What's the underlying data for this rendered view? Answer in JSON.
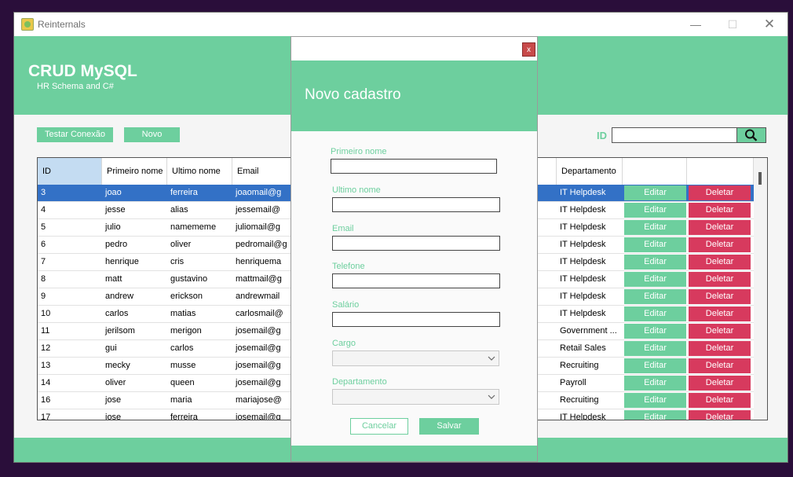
{
  "window": {
    "title": "Reinternals",
    "minimize_glyph": "—",
    "maximize_glyph": "☐",
    "close_glyph": "✕"
  },
  "header": {
    "title": "CRUD MySQL",
    "subtitle": "HR Schema and C#"
  },
  "toolbar": {
    "test_connection_label": "Testar Conexão",
    "new_label": "Novo",
    "id_label": "ID",
    "id_value": ""
  },
  "grid": {
    "columns": [
      "ID",
      "Primeiro nome",
      "Ultimo nome",
      "Email",
      "Departamento",
      "",
      ""
    ],
    "edit_label": "Editar",
    "delete_label": "Deletar",
    "rows": [
      {
        "id": "3",
        "first": "joao",
        "last": "ferreira",
        "email": "joaomail@g",
        "dept": "IT Helpdesk"
      },
      {
        "id": "4",
        "first": "jesse",
        "last": "alias",
        "email": "jessemail@",
        "dept": "IT Helpdesk"
      },
      {
        "id": "5",
        "first": "julio",
        "last": "namememe",
        "email": "juliomail@g",
        "dept": "IT Helpdesk"
      },
      {
        "id": "6",
        "first": "pedro",
        "last": "oliver",
        "email": "pedromail@g",
        "dept": "IT Helpdesk"
      },
      {
        "id": "7",
        "first": "henrique",
        "last": "cris",
        "email": "henriquema",
        "dept": "IT Helpdesk"
      },
      {
        "id": "8",
        "first": "matt",
        "last": "gustavino",
        "email": "mattmail@g",
        "dept": "IT Helpdesk"
      },
      {
        "id": "9",
        "first": "andrew",
        "last": "erickson",
        "email": "andrewmail",
        "dept": "IT Helpdesk"
      },
      {
        "id": "10",
        "first": "carlos",
        "last": "matias",
        "email": "carlosmail@",
        "dept": "IT Helpdesk"
      },
      {
        "id": "11",
        "first": "jerilsom",
        "last": "merigon",
        "email": "josemail@g",
        "dept": "Government ..."
      },
      {
        "id": "12",
        "first": "gui",
        "last": "carlos",
        "email": "josemail@g",
        "dept": "Retail Sales"
      },
      {
        "id": "13",
        "first": "mecky",
        "last": "musse",
        "email": "josemail@g",
        "dept": "Recruiting"
      },
      {
        "id": "14",
        "first": "oliver",
        "last": "queen",
        "email": "josemail@g",
        "dept": "Payroll"
      },
      {
        "id": "16",
        "first": "jose",
        "last": "maria",
        "email": "mariajose@",
        "dept": "Recruiting"
      },
      {
        "id": "17",
        "first": "jose",
        "last": "ferreira",
        "email": "josemail@g",
        "dept": "IT Helpdesk"
      }
    ]
  },
  "modal": {
    "close_label": "x",
    "title": "Novo cadastro",
    "fields": {
      "first_name": {
        "label": "Primeiro nome",
        "value": ""
      },
      "last_name": {
        "label": "Ultimo nome",
        "value": ""
      },
      "email": {
        "label": "Email",
        "value": ""
      },
      "phone": {
        "label": "Telefone",
        "value": ""
      },
      "salary": {
        "label": "Salário",
        "value": ""
      },
      "job": {
        "label": "Cargo",
        "value": ""
      },
      "department": {
        "label": "Departamento",
        "value": ""
      }
    },
    "cancel_label": "Cancelar",
    "save_label": "Salvar"
  },
  "colors": {
    "accent": "#6dcf9e",
    "danger": "#d73a5e",
    "selection": "#3371c6"
  }
}
